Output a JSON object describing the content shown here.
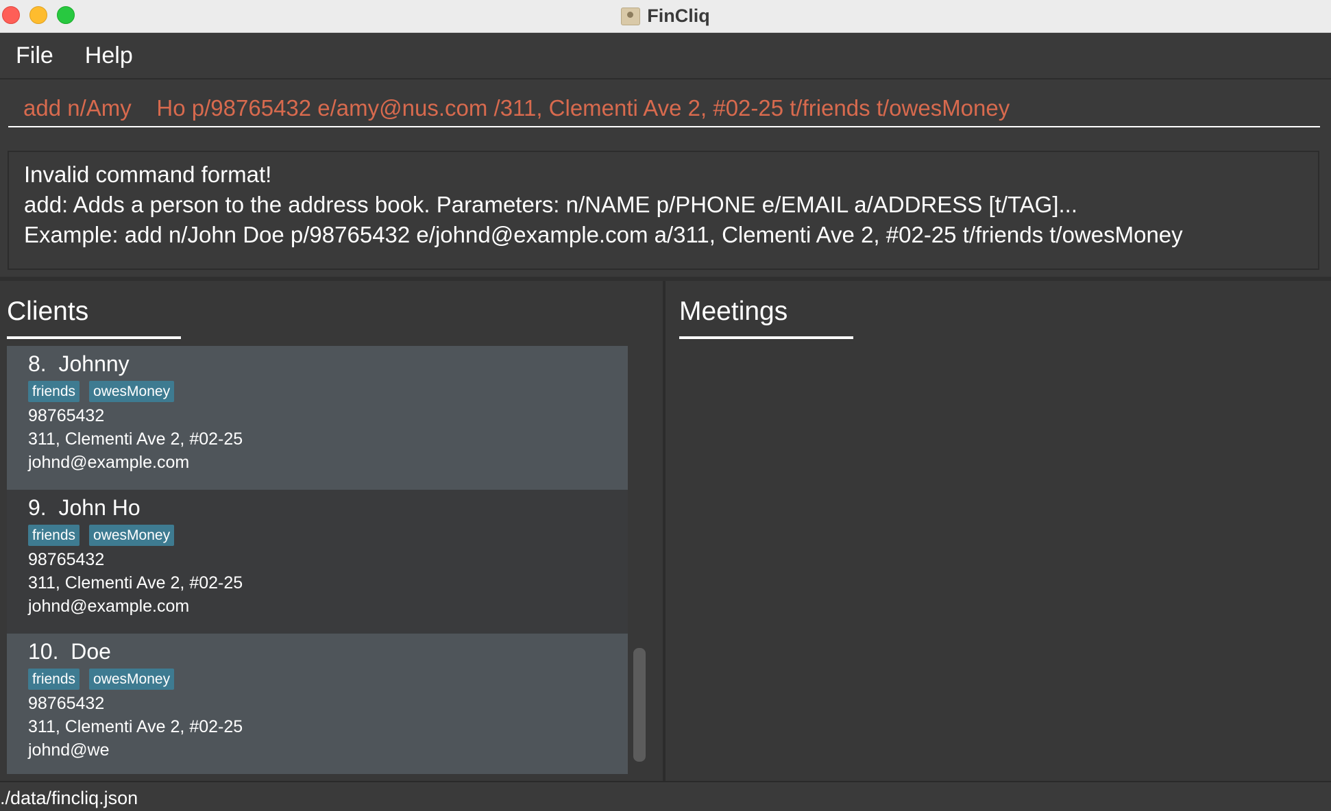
{
  "window": {
    "title": "FinCliq"
  },
  "menu": {
    "file": "File",
    "help": "Help"
  },
  "command_box": {
    "value": "add n/Amy    Ho p/98765432 e/amy@nus.com /311, Clementi Ave 2, #02-25 t/friends t/owesMoney"
  },
  "result_display": {
    "lines": [
      "Invalid command format!",
      "add: Adds a person to the address book. Parameters: n/NAME p/PHONE e/EMAIL a/ADDRESS [t/TAG]...",
      "Example: add n/John Doe p/98765432 e/johnd@example.com a/311, Clementi Ave 2, #02-25 t/friends t/owesMoney"
    ]
  },
  "clients_panel": {
    "title": "Clients",
    "cards": [
      {
        "index": "8.",
        "name": "Johnny",
        "tags": [
          "friends",
          "owesMoney"
        ],
        "phone": "98765432",
        "address": "311, Clementi Ave 2, #02-25",
        "email": "johnd@example.com"
      },
      {
        "index": "9.",
        "name": "John Ho",
        "tags": [
          "friends",
          "owesMoney"
        ],
        "phone": "98765432",
        "address": "311, Clementi Ave 2, #02-25",
        "email": "johnd@example.com"
      },
      {
        "index": "10.",
        "name": "Doe",
        "tags": [
          "friends",
          "owesMoney"
        ],
        "phone": "98765432",
        "address": "311, Clementi Ave 2, #02-25",
        "email": "johnd@we"
      }
    ]
  },
  "meetings_panel": {
    "title": "Meetings"
  },
  "status_bar": {
    "path": "./data/fincliq.json"
  },
  "colors": {
    "background": "#3a3a3a",
    "command_text": "#d86a4e",
    "tag_bg": "#3e7b91",
    "card_light": "#4f555a",
    "card_dark": "#3a3b3d"
  }
}
